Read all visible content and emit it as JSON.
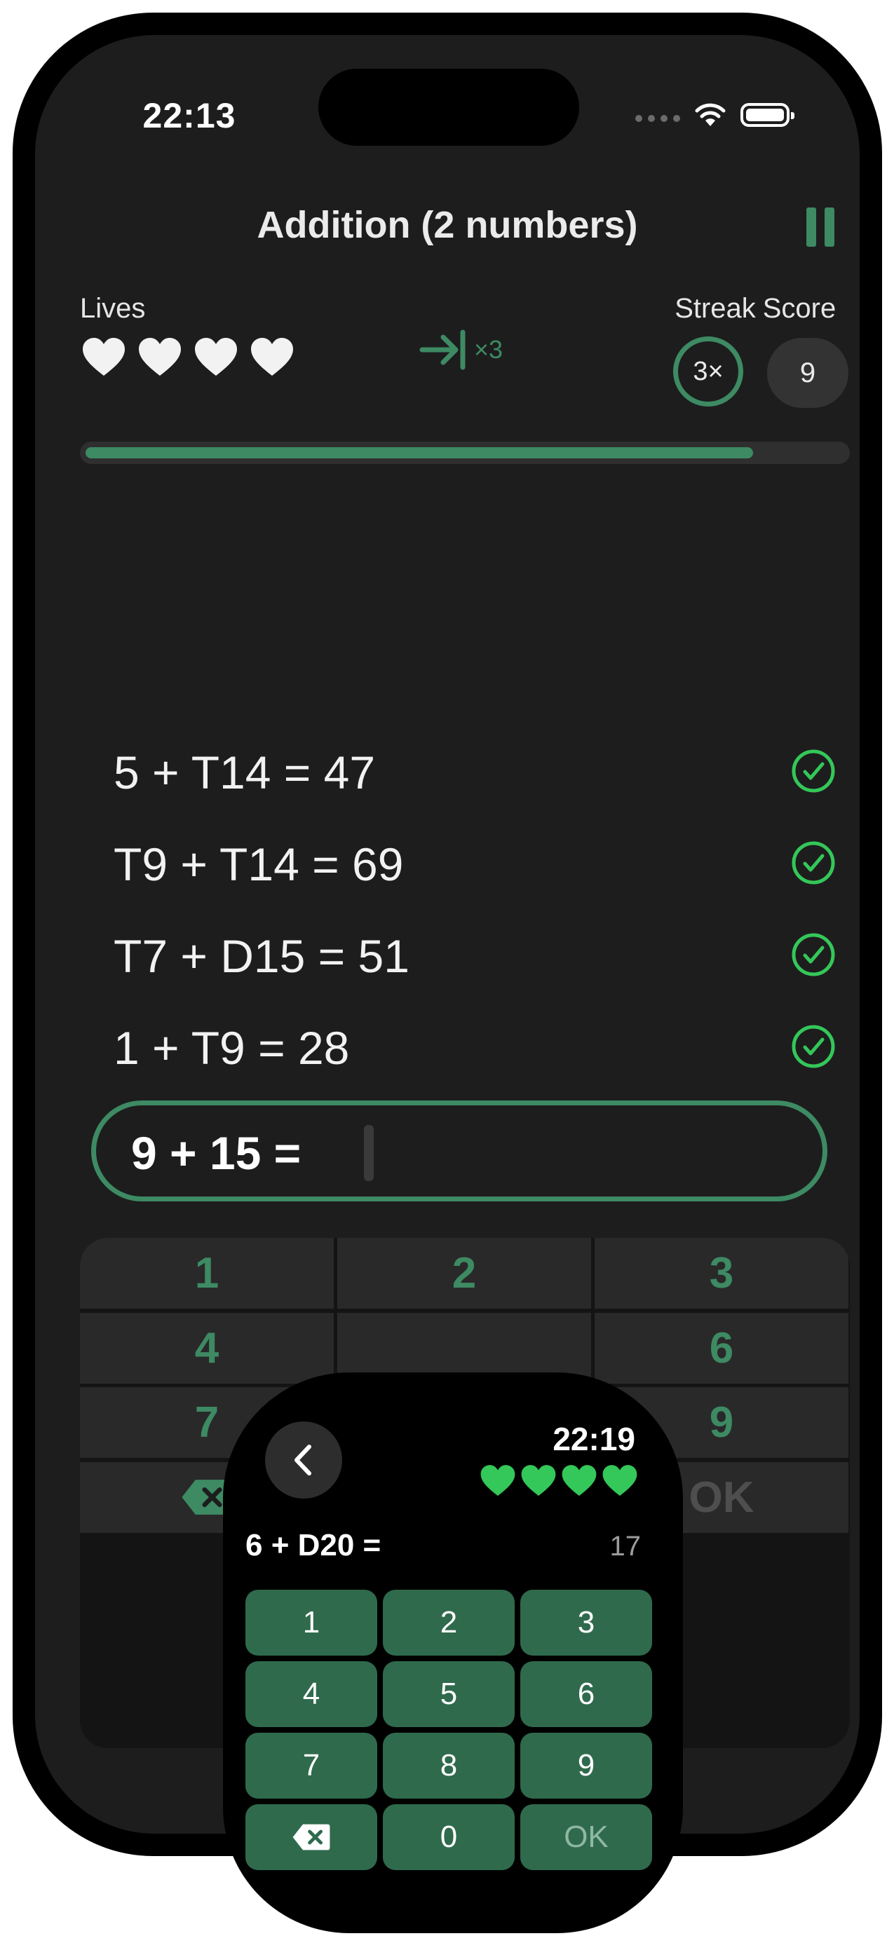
{
  "status_bar": {
    "time": "22:13"
  },
  "header": {
    "title": "Addition (2 numbers)"
  },
  "stats": {
    "lives_label": "Lives",
    "lives_count": 4,
    "skip_multiplier": "×3",
    "streak_label": "Streak",
    "streak_value": "3×",
    "score_label": "Score",
    "score_value": "9"
  },
  "progress": {
    "fraction": 0.88
  },
  "history": [
    {
      "equation": "5 + T14 =  47",
      "correct": true
    },
    {
      "equation": "T9 + T14 =  69",
      "correct": true
    },
    {
      "equation": "T7 + D15 =  51",
      "correct": true
    },
    {
      "equation": "1 + T9 =  28",
      "correct": true
    }
  ],
  "current": {
    "question": "9 + 15 =",
    "answer": ""
  },
  "keypad": {
    "keys": [
      "1",
      "2",
      "3",
      "4",
      "",
      "6",
      "7",
      "",
      "9",
      "backspace",
      "",
      "OK"
    ]
  },
  "watch": {
    "time": "22:19",
    "lives_count": 4,
    "question": "6 + D20 =",
    "hint": "17",
    "keys": [
      "1",
      "2",
      "3",
      "4",
      "5",
      "6",
      "7",
      "8",
      "9",
      "backspace",
      "0",
      "OK"
    ]
  },
  "colors": {
    "accent": "#3d8a63",
    "correct": "#34c759",
    "watch_key": "#2f6a4d",
    "background": "#1d1d1e"
  }
}
